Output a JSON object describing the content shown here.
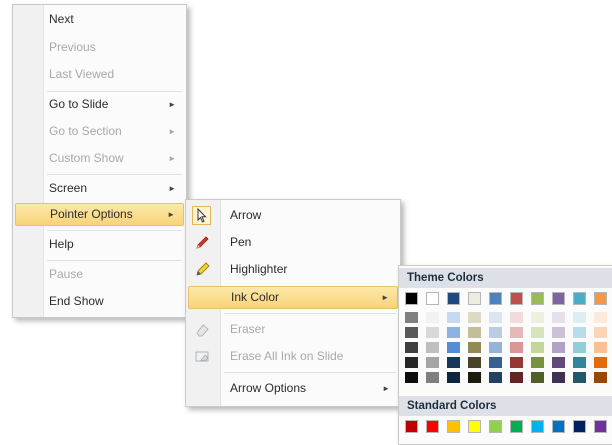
{
  "menu1": {
    "items": [
      {
        "label": "Next",
        "disabled": false,
        "submenu": false
      },
      {
        "label": "Previous",
        "disabled": true,
        "submenu": false
      },
      {
        "label": "Last Viewed",
        "disabled": true,
        "submenu": false
      },
      {
        "label": "Go to Slide",
        "disabled": false,
        "submenu": true
      },
      {
        "label": "Go to Section",
        "disabled": true,
        "submenu": true
      },
      {
        "label": "Custom Show",
        "disabled": true,
        "submenu": true
      },
      {
        "label": "Screen",
        "disabled": false,
        "submenu": true
      },
      {
        "label": "Pointer Options",
        "disabled": false,
        "submenu": true,
        "highlighted": true
      },
      {
        "label": "Help",
        "disabled": false,
        "submenu": false
      },
      {
        "label": "Pause",
        "disabled": true,
        "submenu": false
      },
      {
        "label": "End Show",
        "disabled": false,
        "submenu": false
      }
    ]
  },
  "menu2": {
    "items": [
      {
        "label": "Arrow",
        "icon": "arrow-pointer-icon",
        "checked": true
      },
      {
        "label": "Pen",
        "icon": "pen-icon"
      },
      {
        "label": "Highlighter",
        "icon": "highlighter-icon"
      },
      {
        "label": "Ink Color",
        "submenu": true,
        "highlighted": true
      },
      {
        "label": "Eraser",
        "icon": "eraser-icon",
        "disabled": true
      },
      {
        "label": "Erase All Ink on Slide",
        "icon": "erase-all-icon",
        "disabled": true
      },
      {
        "label": "Arrow Options",
        "submenu": true
      }
    ]
  },
  "menu3": {
    "theme_header": "Theme Colors",
    "standard_header": "Standard Colors",
    "theme_colors": [
      "#000000",
      "#ffffff",
      "#1f497d",
      "#eeece1",
      "#4f81bd",
      "#c0504d",
      "#9bbb59",
      "#8064a2",
      "#4bacc6",
      "#f79646"
    ],
    "theme_shades": [
      [
        "#7f7f7f",
        "#595959",
        "#3f3f3f",
        "#262626",
        "#0c0c0c"
      ],
      [
        "#f2f2f2",
        "#d8d8d8",
        "#bfbfbf",
        "#a5a5a5",
        "#7f7f7f"
      ],
      [
        "#c6d9f0",
        "#8db3e2",
        "#548dd4",
        "#17365d",
        "#0f243e"
      ],
      [
        "#ddd9c3",
        "#c4bd97",
        "#938953",
        "#494429",
        "#1d1b10"
      ],
      [
        "#dbe5f1",
        "#b8cce4",
        "#95b3d7",
        "#366092",
        "#244061"
      ],
      [
        "#f2dcdb",
        "#e5b9b7",
        "#d99694",
        "#953734",
        "#632423"
      ],
      [
        "#ebf1dd",
        "#d7e3bc",
        "#c3d69b",
        "#76923c",
        "#4f6128"
      ],
      [
        "#e5e0ec",
        "#ccc1d9",
        "#b2a2c7",
        "#5f497a",
        "#3f3151"
      ],
      [
        "#dbeef3",
        "#b7dde8",
        "#92cddc",
        "#31859b",
        "#205867"
      ],
      [
        "#fdeada",
        "#fbd5b5",
        "#fac08f",
        "#e36c09",
        "#974806"
      ]
    ],
    "standard_colors": [
      "#c00000",
      "#ff0000",
      "#ffc000",
      "#ffff00",
      "#92d050",
      "#00b050",
      "#00b0f0",
      "#0070c0",
      "#002060",
      "#7030a0"
    ]
  }
}
